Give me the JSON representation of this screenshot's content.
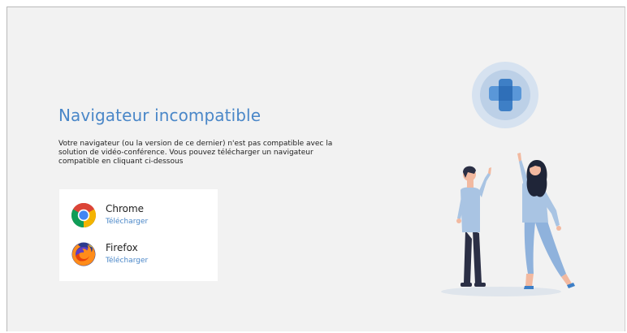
{
  "title": "Navigateur incompatible",
  "description": "Votre navigateur (ou la version de ce dernier) n'est pas compatible avec la solution de vidéo-conférence. Vous pouvez télécharger un navigateur compatible en cliquant ci-dessous",
  "browsers": [
    {
      "name": "Chrome",
      "download_label": "Télécharger",
      "icon": "chrome-icon"
    },
    {
      "name": "Firefox",
      "download_label": "Télécharger",
      "icon": "firefox-icon"
    }
  ],
  "illustration": {
    "icon": "plus-cross-icon",
    "people": "two-people-reaching-icon"
  },
  "colors": {
    "accent": "#4a87c8",
    "background": "#f2f2f2",
    "card": "#ffffff",
    "text": "#222222"
  }
}
